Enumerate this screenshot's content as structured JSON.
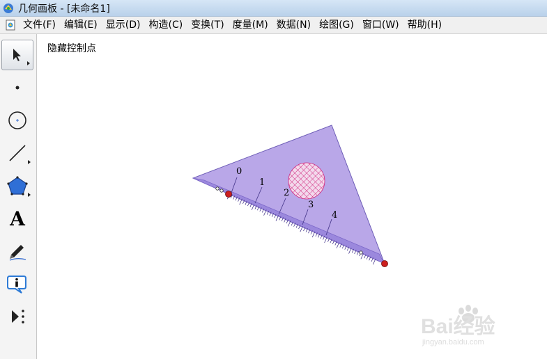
{
  "window": {
    "title": "几何画板 - [未命名1]"
  },
  "menu": [
    {
      "id": "file",
      "label": "文件(F)"
    },
    {
      "id": "edit",
      "label": "编辑(E)"
    },
    {
      "id": "display",
      "label": "显示(D)"
    },
    {
      "id": "construct",
      "label": "构造(C)"
    },
    {
      "id": "transform",
      "label": "变换(T)"
    },
    {
      "id": "measure",
      "label": "度量(M)"
    },
    {
      "id": "data",
      "label": "数据(N)"
    },
    {
      "id": "graph",
      "label": "绘图(G)"
    },
    {
      "id": "window",
      "label": "窗口(W)"
    },
    {
      "id": "help",
      "label": "帮助(H)"
    }
  ],
  "toolbar": {
    "tools": [
      {
        "id": "select",
        "icon": "arrow-select-icon",
        "active": true
      },
      {
        "id": "point",
        "icon": "point-icon"
      },
      {
        "id": "compass",
        "icon": "compass-circle-icon"
      },
      {
        "id": "straightedge",
        "icon": "line-segment-icon"
      },
      {
        "id": "polygon",
        "icon": "polygon-icon"
      },
      {
        "id": "text",
        "icon": "text-icon",
        "label": "A"
      },
      {
        "id": "marker",
        "icon": "marker-pen-icon"
      },
      {
        "id": "info",
        "icon": "info-icon"
      },
      {
        "id": "custom",
        "icon": "custom-tool-icon"
      }
    ]
  },
  "canvas": {
    "button_label": "隐藏控制点",
    "triangle_fill": "#b9a7e8",
    "ruler_fill": "#9b88dd",
    "hole_color": "#d0227a",
    "control_point_color": "#cc1f1f",
    "ruler_labels": [
      "0",
      "1",
      "2",
      "3",
      "4"
    ]
  },
  "watermark": {
    "brand": "Bai经验",
    "url": "jingyan.baidu.com"
  }
}
